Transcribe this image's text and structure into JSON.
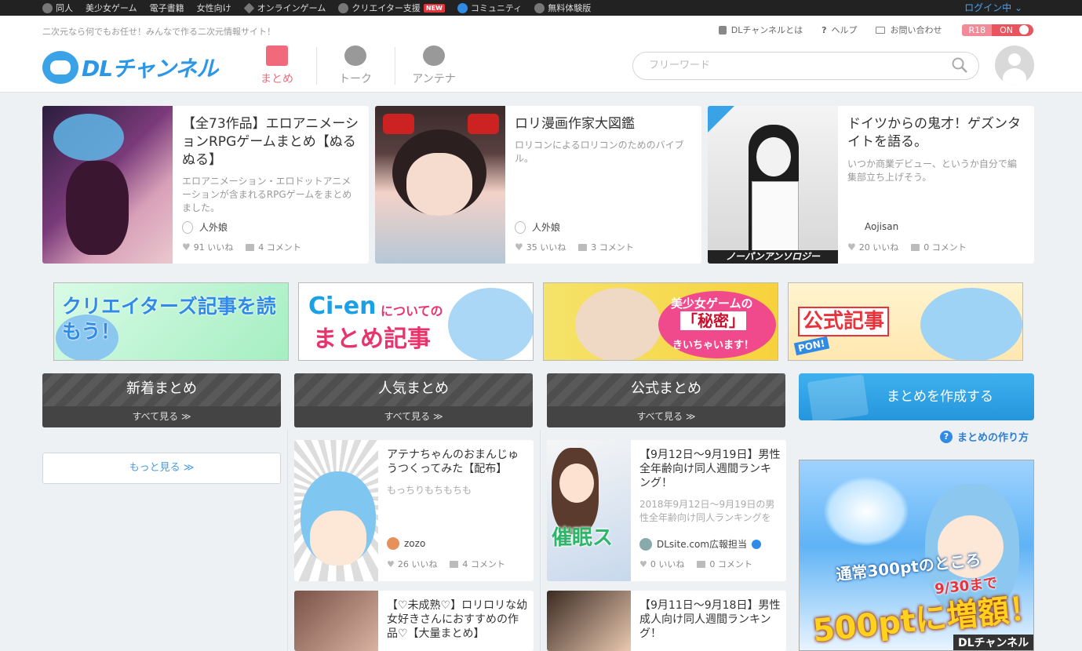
{
  "topbar": {
    "items": [
      {
        "label": "同人",
        "icon": "dl-icon"
      },
      {
        "label": "美少女ゲーム"
      },
      {
        "label": "電子書籍"
      },
      {
        "label": "女性向け"
      },
      {
        "label": "オンラインゲーム",
        "icon": "diamond-icon"
      },
      {
        "label": "クリエイター支援",
        "icon": "cien-icon",
        "badge": "NEW"
      },
      {
        "label": "コミュニティ",
        "icon": "chat-icon"
      },
      {
        "label": "無料体験版",
        "icon": "controller-icon"
      }
    ],
    "login": "ログイン中 ⌄"
  },
  "header": {
    "tagline": "二次元なら何でもお任せ！みんなで作る二次元情報サイト！",
    "links": [
      {
        "label": "DLチャンネルとは"
      },
      {
        "label": "ヘルプ"
      },
      {
        "label": "お問い合わせ"
      }
    ],
    "r18": "R18",
    "r18_state": "ON",
    "logo": "DLチャンネル",
    "tabs": [
      {
        "label": "まとめ",
        "active": true
      },
      {
        "label": "トーク"
      },
      {
        "label": "アンテナ"
      }
    ],
    "search_placeholder": "フリーワード"
  },
  "featured": [
    {
      "title": "【全73作品】エロアニメーションRPGゲームまとめ【ぬるぬる】",
      "desc": "エロアニメーション・エロドットアニメーションが含まれるRPGゲームをまとめました。",
      "author": "人外娘",
      "likes": "91 いいね",
      "comments": "4 コメント"
    },
    {
      "title": "ロリ漫画作家大図鑑",
      "desc": "ロリコンによるロリコンのためのバイブル。",
      "author": "人外娘",
      "likes": "35 いいね",
      "comments": "3 コメント"
    },
    {
      "title": "ドイツからの鬼才！ゲズンタイトを語る。",
      "desc": "いつか商業デビュー、というか自分で編集部立ち上げそう。",
      "author": "Aojisan",
      "likes": "20 いいね",
      "comments": "0 コメント",
      "thumb_caption": "ノーパンアンソロジー"
    }
  ],
  "banners": [
    {
      "text": "クリエイターズ記事を読もう！"
    },
    {
      "text_a": "Ci-en",
      "text_b": "についての",
      "text_c": "まとめ記事"
    },
    {
      "text_a": "美少女ゲームの",
      "text_b": "「秘密」",
      "text_c": "きいちゃいます！"
    },
    {
      "text": "公式記事",
      "tag": "PON!"
    }
  ],
  "columns": [
    {
      "title": "新着まとめ",
      "see_all": "すべて見る ≫"
    },
    {
      "title": "人気まとめ",
      "see_all": "すべて見る ≫"
    },
    {
      "title": "公式まとめ",
      "see_all": "すべて見る ≫"
    }
  ],
  "more_label": "もっと見る ≫",
  "popular": [
    {
      "title": "アテナちゃんのおまんじゅうつくってみた【配布】",
      "desc": "もっちりもちもちも",
      "author": "zozo",
      "likes": "26 いいね",
      "comments": "4 コメント"
    },
    {
      "title": "【♡未成熟♡】ロリロリな幼女好きさんにおすすめの作品♡【大量まとめ】"
    }
  ],
  "official": [
    {
      "title": "【9月12日～9月19日】男性全年齢向け同人週間ランキング！",
      "desc": "2018年9月12日～9月19日の男性全年齢向け同人ランキングを",
      "author": "DLsite.com広報担当",
      "likes": "0 いいね",
      "comments": "0 コメント",
      "thumb_caption": "催眠ス"
    },
    {
      "title": "【9月11日～9月18日】男性成人向け同人週間ランキング！"
    }
  ],
  "sidebar": {
    "create_label": "まとめを作成する",
    "howto_label": "まとめの作り方",
    "promo": {
      "line1": "通常300ptのところ",
      "line2": "9/30まで",
      "line3": "500ptに増額！",
      "line4": "DLチャンネル"
    }
  }
}
